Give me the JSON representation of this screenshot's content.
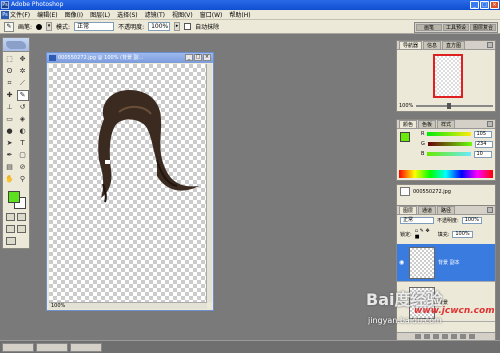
{
  "window": {
    "title": "Adobe Photoshop",
    "app_icon": "ps-icon"
  },
  "menu": [
    "文件(F)",
    "编辑(E)",
    "图像(I)",
    "图层(L)",
    "选择(S)",
    "滤镜(T)",
    "视图(V)",
    "窗口(W)",
    "帮助(H)"
  ],
  "options": {
    "brush_label": "画笔:",
    "mode_label": "模式:",
    "mode_value": "正常",
    "opacity_label": "不透明度:",
    "opacity_value": "100%",
    "erase_to_history_label": "自动抹除"
  },
  "palette_well": [
    "画笔",
    "工具预设",
    "图层复合"
  ],
  "document": {
    "title": "000550272.jpg @ 100% (背景 副...",
    "zoom": "100%",
    "title_buttons": [
      "_",
      "□",
      "×"
    ]
  },
  "navigator": {
    "tabs": [
      "导航器",
      "信息",
      "直方图"
    ],
    "zoom": "100%"
  },
  "color": {
    "tabs": [
      "颜色",
      "色板",
      "样式"
    ],
    "channels": [
      {
        "label": "R",
        "value": "105",
        "bar": "linear-gradient(90deg,#00ea0a,#ffea0a)"
      },
      {
        "label": "G",
        "value": "234",
        "bar": "linear-gradient(90deg,#69000a,#69ff0a)"
      },
      {
        "label": "B",
        "value": "10",
        "bar": "linear-gradient(90deg,#69ea00,#69eaff)"
      }
    ],
    "foreground": "#69ea0a"
  },
  "history": {
    "item": "000550272.jpg"
  },
  "layers": {
    "tabs": [
      "图层",
      "通道",
      "路径"
    ],
    "blend": "正常",
    "opacity_label": "不透明度:",
    "opacity": "100%",
    "lock_label": "锁定:",
    "fill_label": "填充:",
    "fill": "100%",
    "rows": [
      {
        "name": "背景 副本",
        "selected": true
      },
      {
        "name": "背景",
        "selected": false
      }
    ]
  },
  "watermark": {
    "logo": "Bai度经验",
    "url": "jingyan.baidu.com",
    "cool": "www.jcwcn.com"
  },
  "taskbar": [
    "",
    "",
    ""
  ]
}
